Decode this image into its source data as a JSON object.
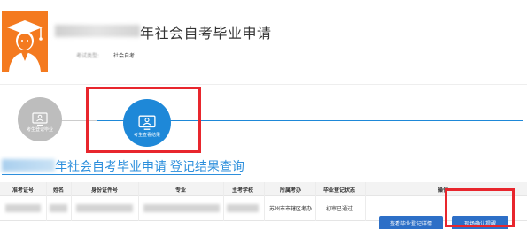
{
  "page": {
    "title": "年社会自考毕业申请",
    "exam_type_label": "考试类型:",
    "exam_type_value": "社会自考"
  },
  "steps": [
    {
      "label": "考生登记毕业"
    },
    {
      "label": "考生查看结果"
    }
  ],
  "result_heading": "年社会自考毕业申请 登记结果查询",
  "table": {
    "headers": [
      "准考证号",
      "姓名",
      "身份证件号",
      "专业",
      "主考学校",
      "所属考办",
      "毕业登记状态",
      "操作"
    ],
    "row": {
      "office": "苏州市市辖区考办",
      "status": "初审已通过",
      "detail_button": "查看毕业登记详情",
      "confirm_button": "现场确认提醒"
    }
  },
  "colors": {
    "accent_blue": "#1e88d8",
    "highlight_red": "#e8262d",
    "avatar_orange": "#f47a1f",
    "button_blue": "#2d6fc7"
  }
}
